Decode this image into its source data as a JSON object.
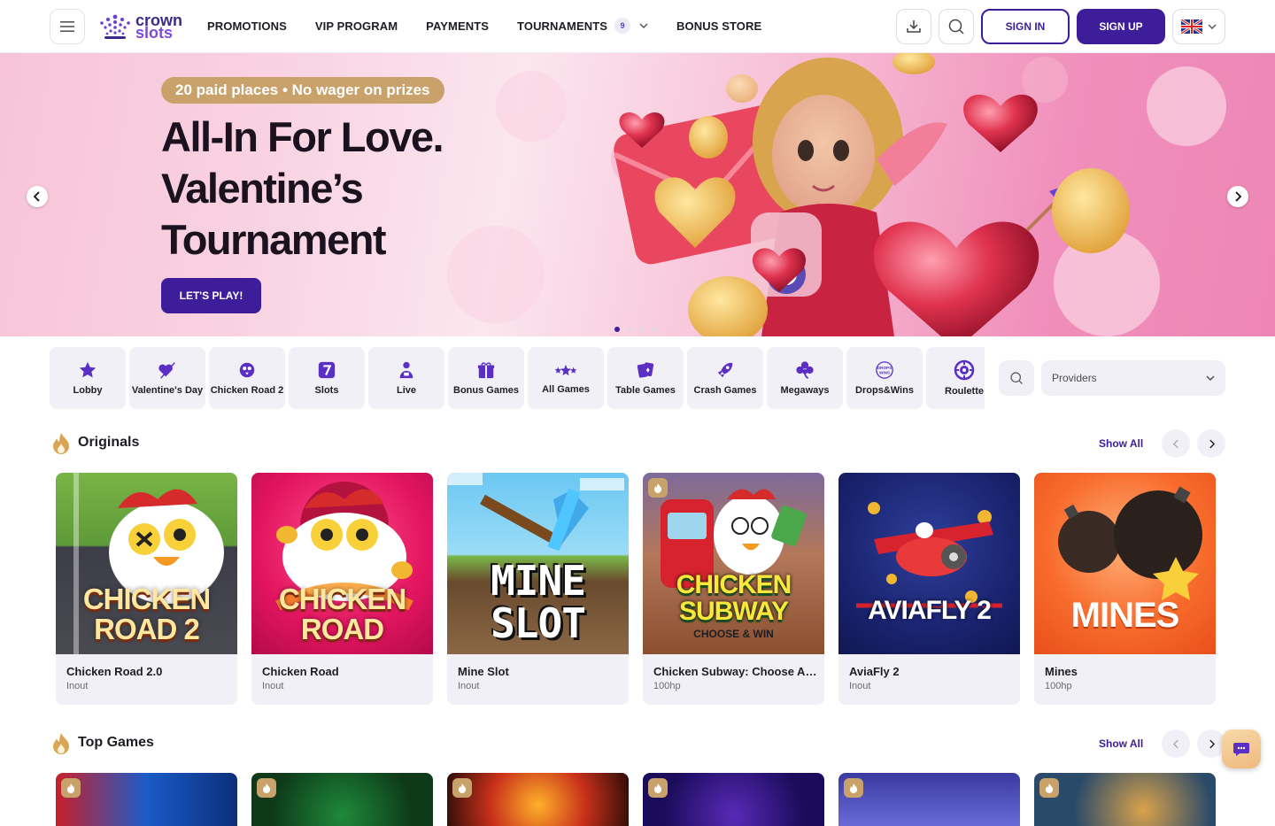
{
  "header": {
    "logo_line1": "crown",
    "logo_line2": "slots",
    "nav": [
      {
        "label": "PROMOTIONS"
      },
      {
        "label": "VIP PROGRAM"
      },
      {
        "label": "PAYMENTS"
      },
      {
        "label": "TOURNAMENTS",
        "badge": "9"
      },
      {
        "label": "BONUS STORE"
      }
    ],
    "sign_in": "SIGN IN",
    "sign_up": "SIGN UP"
  },
  "hero": {
    "pill": "20 paid places • No wager on prizes",
    "title_lines": [
      "All-In For Love.",
      "Valentine’s",
      "Tournament"
    ],
    "cta": "LET'S PLAY!",
    "slides": 4,
    "active_slide": 1
  },
  "categories": [
    {
      "label": "Lobby",
      "icon": "star-icon"
    },
    {
      "label": "Valentine's Day",
      "icon": "heart-arrow-icon"
    },
    {
      "label": "Chicken Road 2",
      "icon": "chicken-icon"
    },
    {
      "label": "Slots",
      "icon": "seven-icon"
    },
    {
      "label": "Live",
      "icon": "dealer-icon"
    },
    {
      "label": "Bonus Games",
      "icon": "gift-icon"
    },
    {
      "label": "All Games",
      "icon": "stars-icon"
    },
    {
      "label": "Table Games",
      "icon": "cards-icon"
    },
    {
      "label": "Crash Games",
      "icon": "rocket-icon"
    },
    {
      "label": "Megaways",
      "icon": "clover-icon"
    },
    {
      "label": "Drops&Wins",
      "icon": "drops-wins-icon"
    },
    {
      "label": "Roulette",
      "icon": "roulette-icon"
    }
  ],
  "providers": {
    "placeholder": "Providers"
  },
  "originals": {
    "title": "Originals",
    "show_all": "Show All",
    "games": [
      {
        "name": "Chicken Road 2.0",
        "provider": "Inout",
        "art": "CHICKEN ROAD 2"
      },
      {
        "name": "Chicken Road",
        "provider": "Inout",
        "art": "CHICKEN ROAD"
      },
      {
        "name": "Mine Slot",
        "provider": "Inout",
        "art": "MINE SLOT"
      },
      {
        "name": "Chicken Subway: Choose An...",
        "provider": "100hp",
        "art": "CHICKEN SUBWAY",
        "art_sub": "CHOOSE & WIN"
      },
      {
        "name": "AviaFly 2",
        "provider": "Inout",
        "art": "AVIAFLY 2"
      },
      {
        "name": "Mines",
        "provider": "100hp",
        "art": "MINES"
      }
    ]
  },
  "top_games": {
    "title": "Top Games",
    "show_all": "Show All"
  },
  "colors": {
    "brand": "#3d1d9a",
    "gold": "#c9a26b",
    "surface": "#f1f0f7"
  }
}
